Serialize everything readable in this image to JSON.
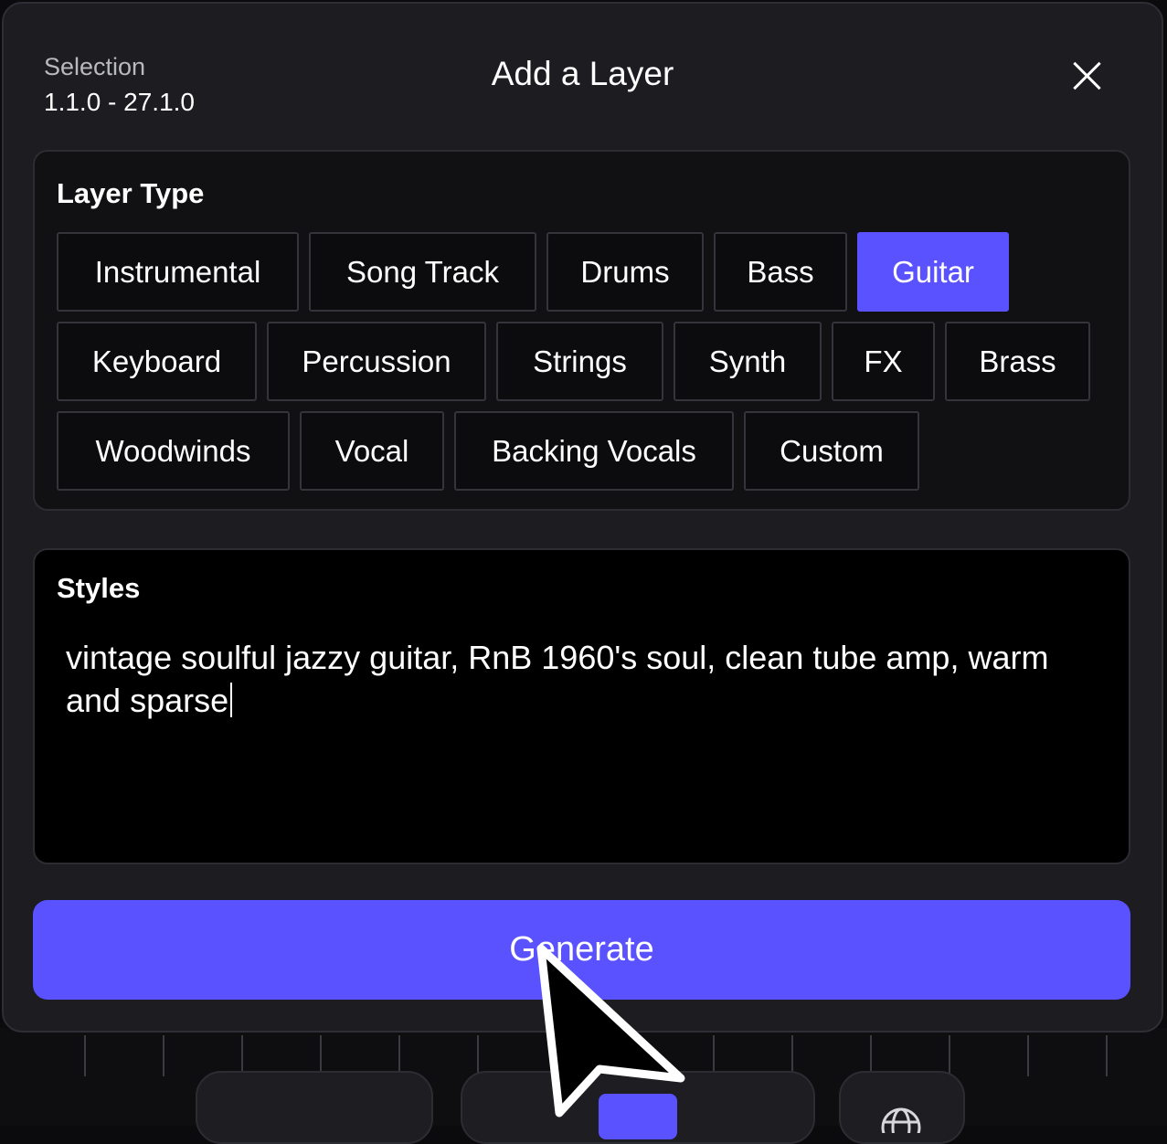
{
  "header": {
    "selection_label": "Selection",
    "selection_value": "1.1.0 - 27.1.0",
    "title": "Add a Layer",
    "close_icon": "close-icon"
  },
  "layer_type": {
    "title": "Layer Type",
    "selected": "Guitar",
    "options": [
      "Instrumental",
      "Song Track",
      "Drums",
      "Bass",
      "Guitar",
      "Keyboard",
      "Percussion",
      "Strings",
      "Synth",
      "FX",
      "Brass",
      "Woodwinds",
      "Vocal",
      "Backing Vocals",
      "Custom"
    ]
  },
  "styles": {
    "title": "Styles",
    "value": "vintage soulful jazzy guitar, RnB 1960's soul, clean tube amp, warm and sparse"
  },
  "generate": {
    "label": "Generate"
  },
  "colors": {
    "accent": "#5b52ff",
    "modal_bg": "#1c1c21",
    "panel_bg": "#111114",
    "chip_bg": "#0c0c0f",
    "input_bg": "#000000"
  }
}
